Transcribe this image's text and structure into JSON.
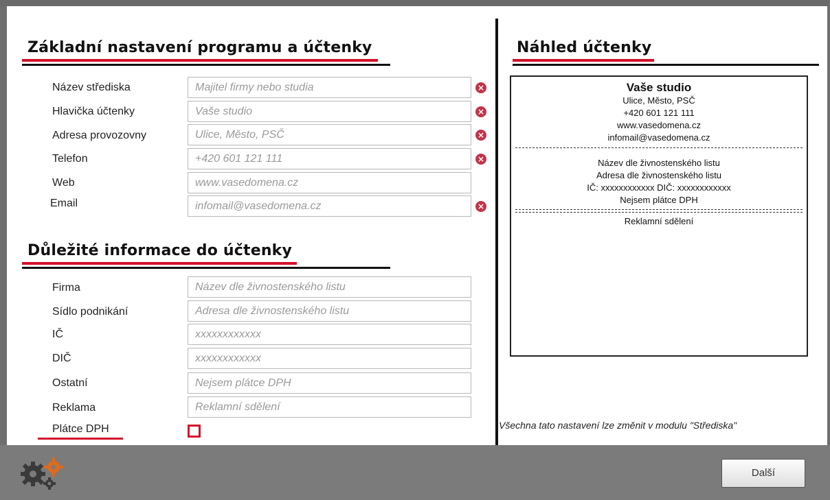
{
  "colors": {
    "accent_red": "#d4112a",
    "clear_icon": "#c2334a",
    "bottom_bar": "#7b7b7b"
  },
  "left_panel": {
    "section1_title": "Základní nastavení programu a účtenky",
    "section1_fields": [
      {
        "label": "Název střediska",
        "placeholder": "Majitel firmy nebo studia",
        "clear_icon": "x-circle-icon"
      },
      {
        "label": "Hlavička účtenky",
        "placeholder": "Vaše studio",
        "clear_icon": "x-circle-icon"
      },
      {
        "label": "Adresa provozovny",
        "placeholder": "Ulice, Město, PSČ",
        "clear_icon": "x-circle-icon"
      },
      {
        "label": "Telefon",
        "placeholder": "+420 601 121 111",
        "clear_icon": "x-circle-icon"
      },
      {
        "label": "Web",
        "placeholder": "www.vasedomena.cz"
      },
      {
        "label": "Email",
        "placeholder": "infomail@vasedomena.cz",
        "clear_icon": "x-circle-icon"
      }
    ],
    "section2_title": "Důležité informace do účtenky",
    "section2_fields": [
      {
        "label": "Firma",
        "placeholder": "Název dle živnostenského listu"
      },
      {
        "label": "Sídlo podnikání",
        "placeholder": "Adresa dle živnostenského listu"
      },
      {
        "label": "IČ",
        "placeholder": "xxxxxxxxxxxx"
      },
      {
        "label": "DIČ",
        "placeholder": "xxxxxxxxxxxx"
      },
      {
        "label": "Ostatní",
        "placeholder": "Nejsem plátce DPH"
      },
      {
        "label": "Reklama",
        "placeholder": "Reklamní sdělení"
      }
    ],
    "vat_payer_label": "Plátce DPH",
    "vat_payer_checked": false
  },
  "right_panel": {
    "title": "Náhled účtenky",
    "receipt": {
      "studio_name": "Vaše studio",
      "address": "Ulice, Město, PSČ",
      "phone": "+420 601 121 111",
      "web": "www.vasedomena.cz",
      "email": "infomail@vasedomena.cz",
      "company": "Název dle živnostenského listu",
      "company_address": "Adresa dle živnostenského listu",
      "ids": "IČ: xxxxxxxxxxxx DIČ: xxxxxxxxxxxx",
      "vat_note": "Nejsem plátce DPH",
      "ad_message": "Reklamní sdělení"
    },
    "footer_note": "Všechna tato nastavení lze změnit v modulu \"Střediska\""
  },
  "bottom_bar": {
    "icon": "gears-icon",
    "next_button_label": "Další"
  }
}
